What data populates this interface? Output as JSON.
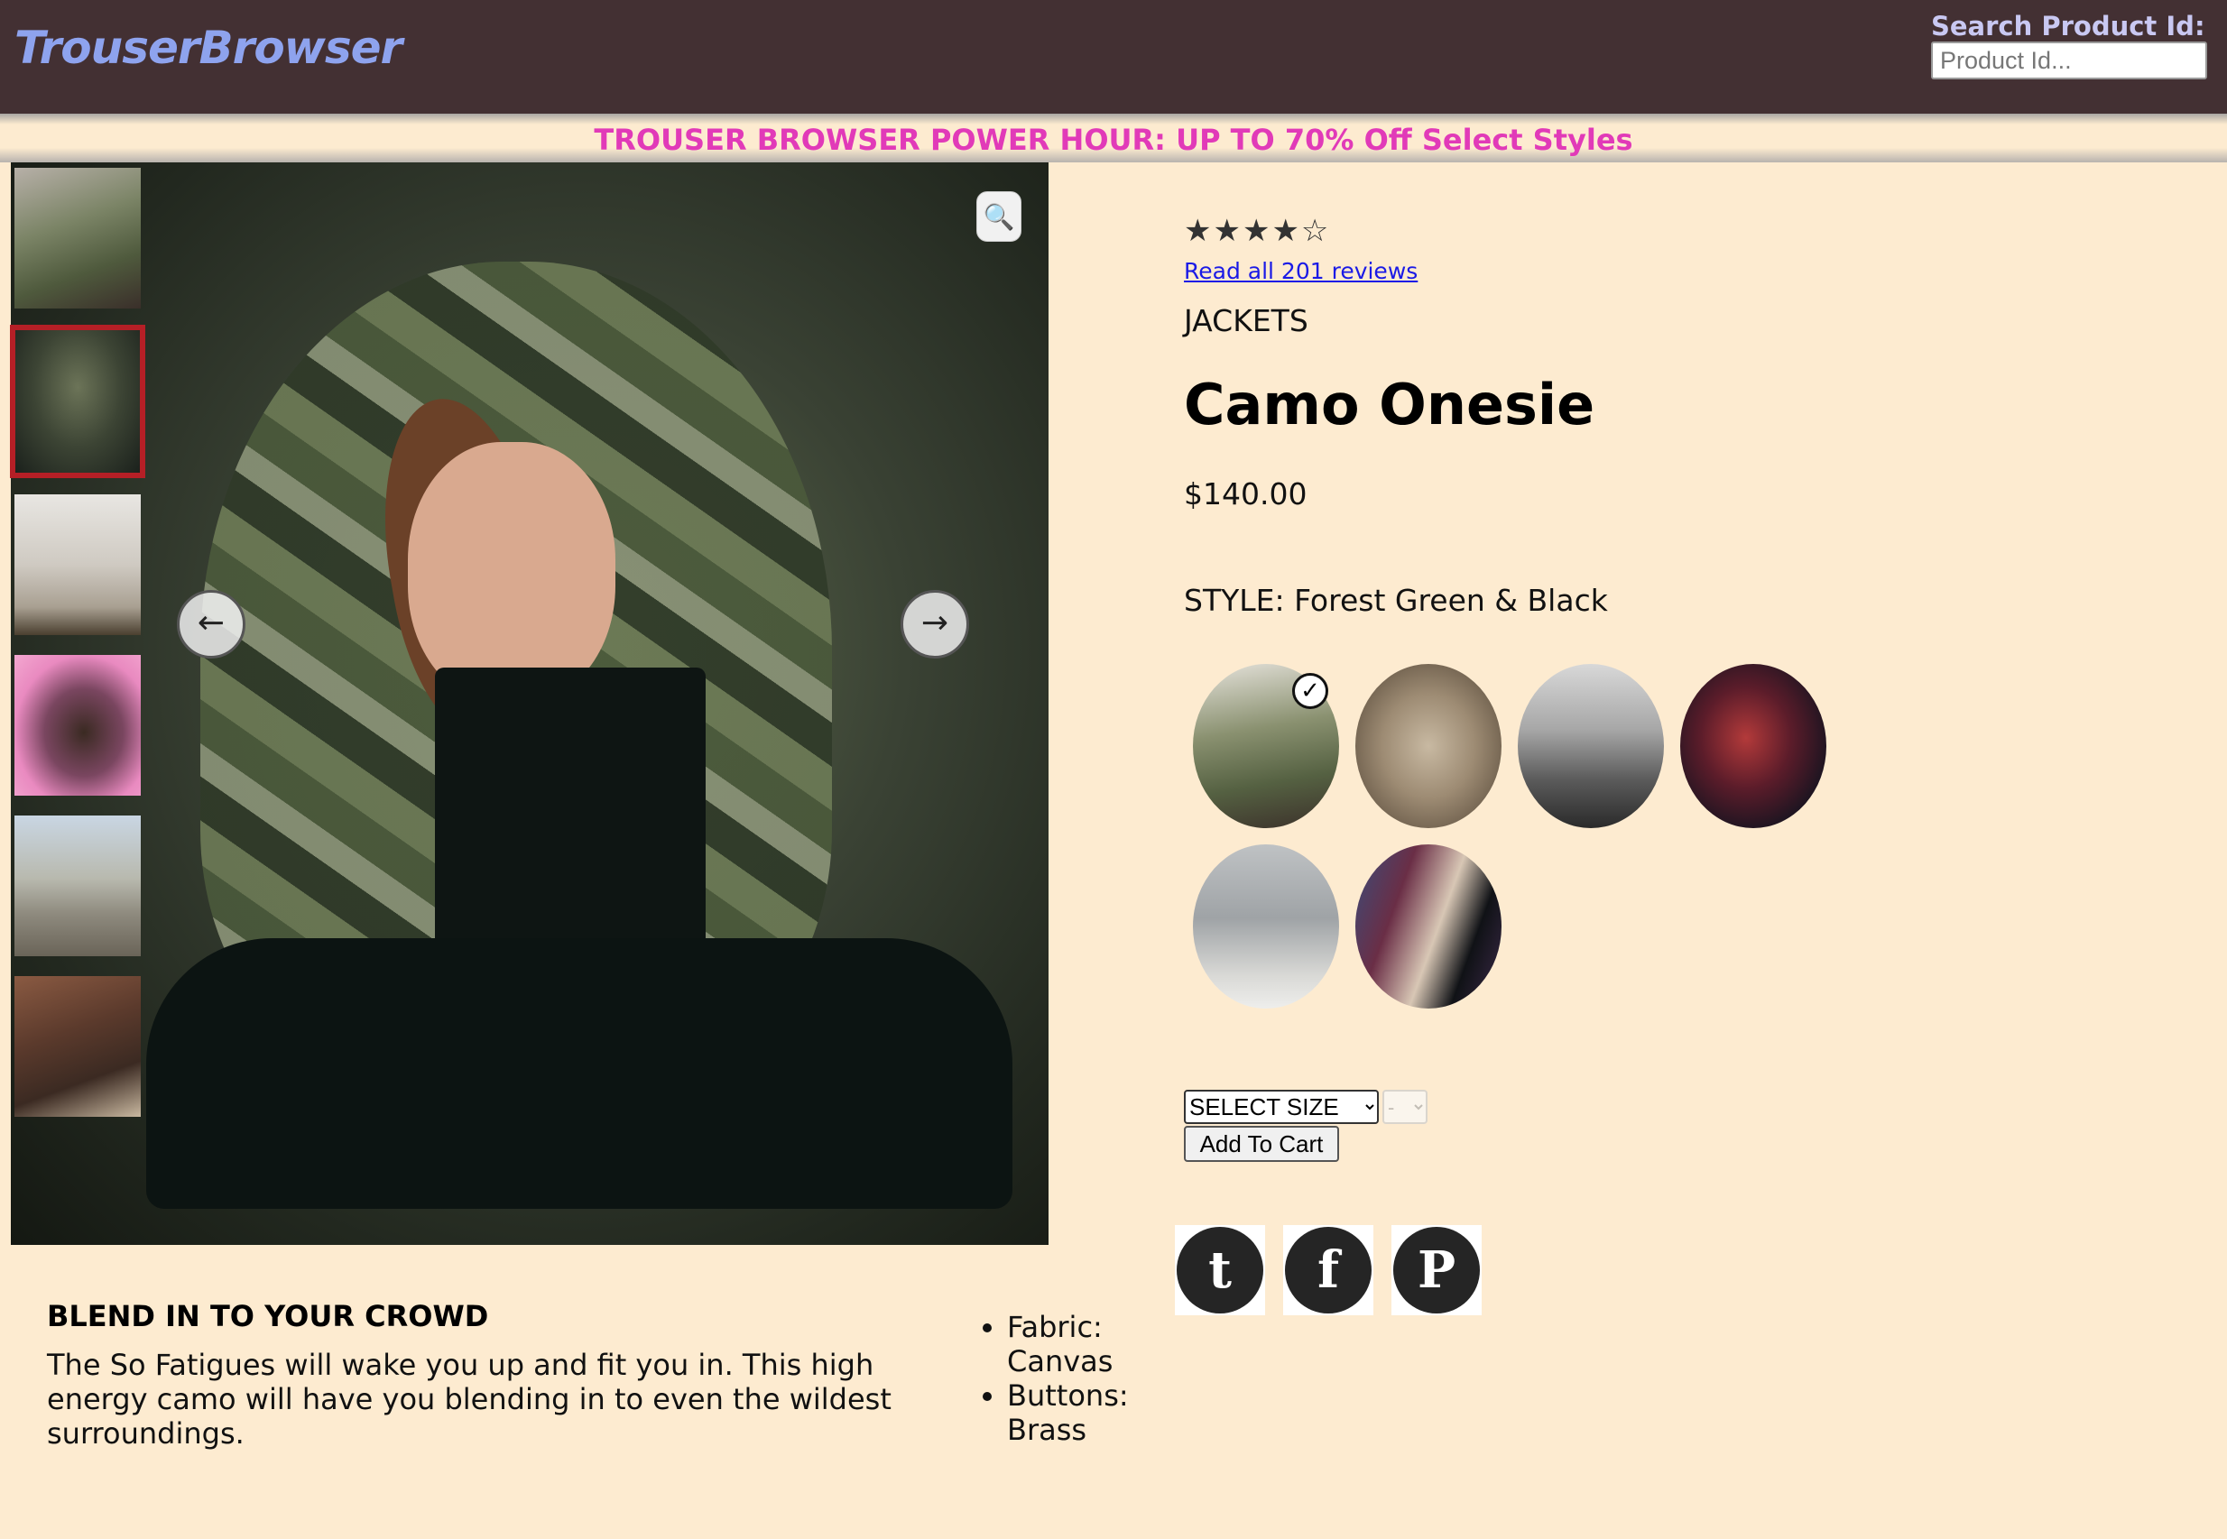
{
  "header": {
    "logo": "TrouserBrowser",
    "search_label": "Search Product Id:",
    "search_placeholder": "Product Id..."
  },
  "promo": {
    "text": "TROUSER BROWSER POWER HOUR: UP TO 70% Off Select Styles"
  },
  "gallery": {
    "thumbnail_count": 6,
    "active_thumbnail_index": 1,
    "zoom_icon": "magnifier-icon",
    "prev_arrow": "←",
    "next_arrow": "→"
  },
  "product": {
    "rating": 4.5,
    "stars_display": "★★★★☆",
    "reviews_link": "Read all 201 reviews",
    "category": "JACKETS",
    "name": "Camo Onesie",
    "price": "$140.00",
    "style_label": "STYLE:",
    "style_value": "Forest Green & Black",
    "style_count": 6,
    "selected_style_index": 0,
    "check_mark": "✓"
  },
  "purchase": {
    "size_select": "SELECT SIZE",
    "qty_select": "-",
    "add_to_cart": "Add To Cart"
  },
  "social": {
    "icons": [
      "twitter-icon",
      "facebook-icon",
      "pinterest-icon"
    ],
    "twitter_glyph": "t",
    "facebook_glyph": "f",
    "pinterest_glyph": "P"
  },
  "description": {
    "heading": "BLEND IN TO YOUR CROWD",
    "body": "The So Fatigues will wake you up and fit you in. This high energy camo will have you blending in to even the wildest surroundings.",
    "features": [
      "Fabric: Canvas",
      "Buttons: Brass"
    ]
  },
  "colors": {
    "header_bg": "#433033",
    "logo": "#8ea3ee",
    "page_bg": "#fdebd0",
    "promo_text": "#e13ab8",
    "active_thumb_border": "#b51f26",
    "link": "#1a1ae6"
  }
}
